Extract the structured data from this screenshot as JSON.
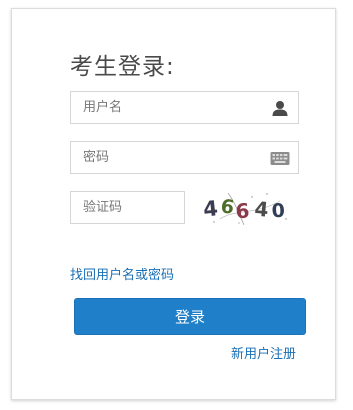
{
  "login": {
    "title": "考生登录:",
    "username": {
      "placeholder": "用户名",
      "value": ""
    },
    "password": {
      "placeholder": "密码",
      "value": ""
    },
    "captcha": {
      "placeholder": "验证码",
      "value": "",
      "image_text": "46640",
      "char_colors": [
        "#3b3b52",
        "#4d6e2a",
        "#8a3a4a",
        "#4b4b4b",
        "#2f3e56"
      ]
    },
    "forgot_link": "找回用户名或密码",
    "login_button": "登录",
    "register_link": "新用户注册",
    "colors": {
      "accent": "#1f80c9",
      "link": "#1a6fb5"
    }
  }
}
